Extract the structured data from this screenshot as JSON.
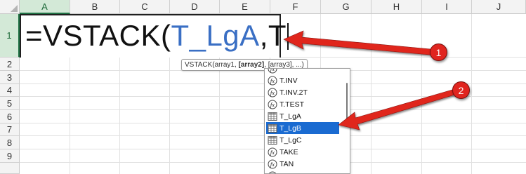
{
  "columns": [
    "A",
    "B",
    "C",
    "D",
    "E",
    "F",
    "G",
    "H",
    "I",
    "J"
  ],
  "rows": [
    "1",
    "2",
    "3",
    "4",
    "5",
    "6",
    "7",
    "8",
    "9"
  ],
  "cell_editor": {
    "prefix": "=VSTACK(",
    "reference": "T_LgA",
    "suffix": ",T"
  },
  "tooltip": {
    "fn": "VSTACK(array1, ",
    "current_arg": "[array2]",
    "rest": ", [array3], ...)"
  },
  "autocomplete": {
    "items": [
      {
        "label": "",
        "icon": "function-icon"
      },
      {
        "label": "T.INV",
        "icon": "function-icon"
      },
      {
        "label": "T.INV.2T",
        "icon": "function-icon"
      },
      {
        "label": "T.TEST",
        "icon": "function-icon"
      },
      {
        "label": "T_LgA",
        "icon": "table-icon"
      },
      {
        "label": "T_LgB",
        "icon": "table-icon",
        "selected": true
      },
      {
        "label": "T_LgC",
        "icon": "table-icon"
      },
      {
        "label": "TAKE",
        "icon": "function-icon"
      },
      {
        "label": "TAN",
        "icon": "function-icon"
      },
      {
        "label": "TANH",
        "icon": "function-icon"
      }
    ]
  },
  "annotations": {
    "badge1": "1",
    "badge2": "2"
  },
  "colors": {
    "accent_green": "#217346",
    "reference_blue": "#3a6fc4",
    "selection_blue": "#1a6bd1",
    "annotation_red": "#e0251f"
  }
}
